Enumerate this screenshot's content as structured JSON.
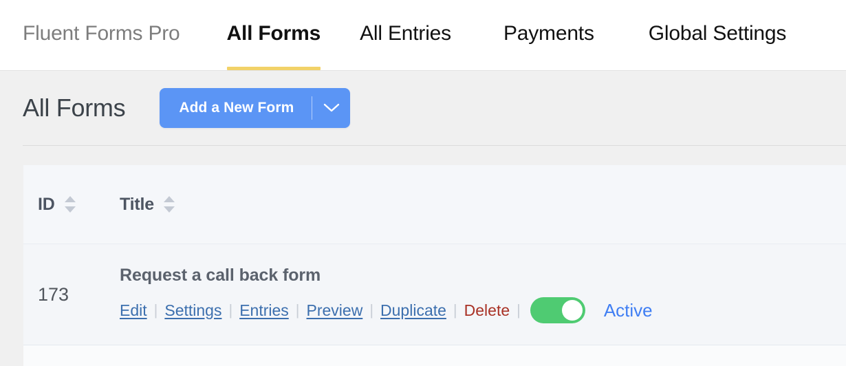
{
  "nav": {
    "brand": "Fluent Forms Pro",
    "items": [
      {
        "label": "All Forms",
        "active": true
      },
      {
        "label": "All Entries",
        "active": false
      },
      {
        "label": "Payments",
        "active": false
      },
      {
        "label": "Global Settings",
        "active": false
      }
    ],
    "active_underline_color": "#f2d268"
  },
  "page": {
    "title": "All Forms",
    "add_button": {
      "label": "Add a New Form",
      "caret_icon": "chevron-down-icon",
      "color": "#5b95f5"
    }
  },
  "table": {
    "columns": [
      {
        "key": "id",
        "label": "ID",
        "sort_icon": "sort-arrows-icon"
      },
      {
        "key": "title",
        "label": "Title",
        "sort_icon": "sort-arrows-icon"
      }
    ],
    "rows": [
      {
        "id": "173",
        "title": "Request a call back form",
        "actions": [
          {
            "label": "Edit",
            "style": "link"
          },
          {
            "label": "Settings",
            "style": "link"
          },
          {
            "label": "Entries",
            "style": "link"
          },
          {
            "label": "Preview",
            "style": "link"
          },
          {
            "label": "Duplicate",
            "style": "link"
          },
          {
            "label": "Delete",
            "style": "danger"
          }
        ],
        "separator": "|",
        "toggle": {
          "state": "on",
          "color": "#4fcb72"
        },
        "status": {
          "label": "Active",
          "color": "#3f7ef3"
        }
      }
    ]
  }
}
